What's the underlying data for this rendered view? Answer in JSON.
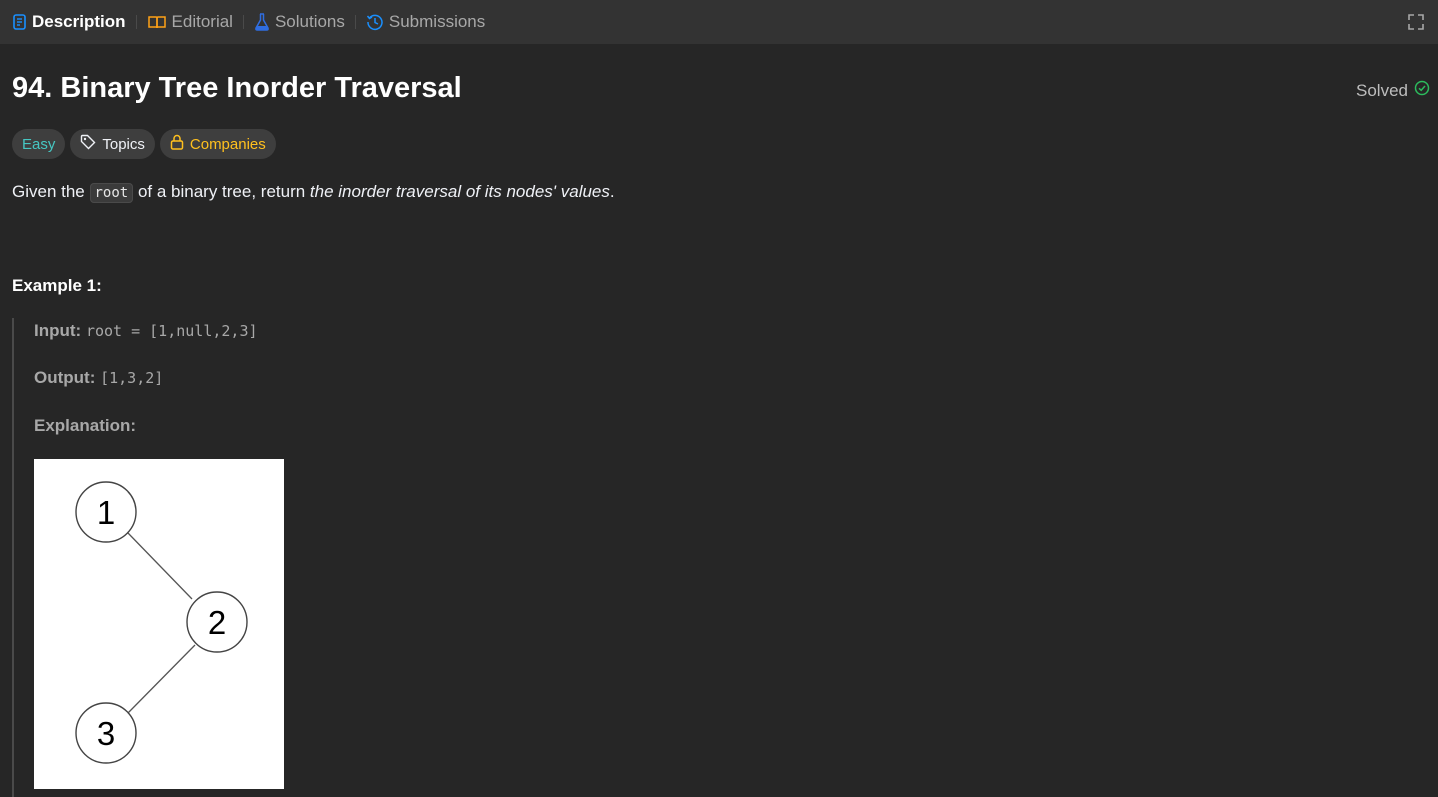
{
  "tabs": [
    {
      "label": "Description",
      "icon": "description-icon",
      "active": true
    },
    {
      "label": "Editorial",
      "icon": "book-icon",
      "active": false
    },
    {
      "label": "Solutions",
      "icon": "flask-icon",
      "active": false
    },
    {
      "label": "Submissions",
      "icon": "history-icon",
      "active": false
    }
  ],
  "problem": {
    "title": "94. Binary Tree Inorder Traversal",
    "status": "Solved",
    "difficulty": "Easy",
    "topics_label": "Topics",
    "companies_label": "Companies",
    "description": {
      "before": "Given the ",
      "code": "root",
      "middle": " of a binary tree, return ",
      "emphasis": "the inorder traversal of its nodes' values",
      "after": "."
    }
  },
  "example1": {
    "heading": "Example 1:",
    "input_label": "Input:",
    "input_value": "root = [1,null,2,3]",
    "output_label": "Output:",
    "output_value": "[1,3,2]",
    "explanation_label": "Explanation:",
    "tree_nodes": [
      "1",
      "2",
      "3"
    ]
  },
  "colors": {
    "background": "#262626",
    "tabbar": "#333333",
    "easy": "#46c6c2",
    "companies": "#ffc01e",
    "solved_check": "#2cbb5d",
    "description_tab_icon": "#1a90ff"
  }
}
